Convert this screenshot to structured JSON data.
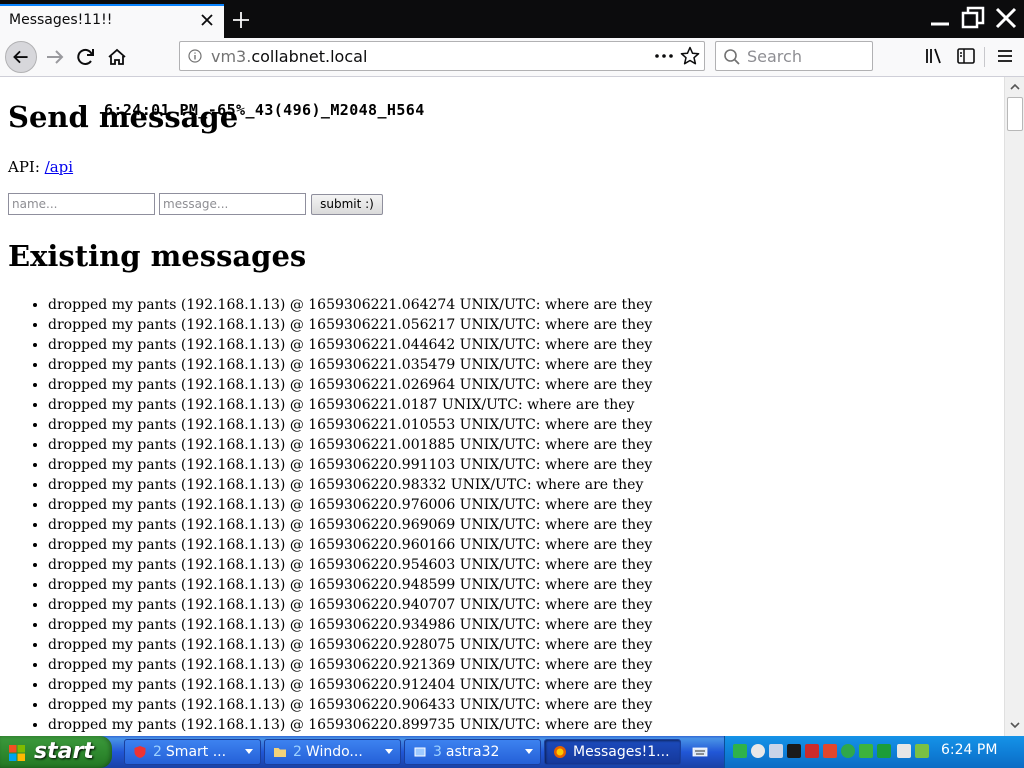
{
  "browser": {
    "tab_title": "Messages!11!!",
    "url_prefix": "vm3.",
    "url_domain": "collabnet.local",
    "search_placeholder": "Search"
  },
  "page": {
    "overlay_stats": "6:24:01 PM_-65%_43(496)_M2048_H564",
    "send_heading": "Send message",
    "api_label": "API: ",
    "api_link": "/api",
    "name_placeholder": "name...",
    "message_placeholder": "message...",
    "submit_label": "submit :)",
    "existing_heading": "Existing messages",
    "messages": [
      "dropped my pants (192.168.1.13) @ 1659306221.064274 UNIX/UTC: where are they",
      "dropped my pants (192.168.1.13) @ 1659306221.056217 UNIX/UTC: where are they",
      "dropped my pants (192.168.1.13) @ 1659306221.044642 UNIX/UTC: where are they",
      "dropped my pants (192.168.1.13) @ 1659306221.035479 UNIX/UTC: where are they",
      "dropped my pants (192.168.1.13) @ 1659306221.026964 UNIX/UTC: where are they",
      "dropped my pants (192.168.1.13) @ 1659306221.0187 UNIX/UTC: where are they",
      "dropped my pants (192.168.1.13) @ 1659306221.010553 UNIX/UTC: where are they",
      "dropped my pants (192.168.1.13) @ 1659306221.001885 UNIX/UTC: where are they",
      "dropped my pants (192.168.1.13) @ 1659306220.991103 UNIX/UTC: where are they",
      "dropped my pants (192.168.1.13) @ 1659306220.98332 UNIX/UTC: where are they",
      "dropped my pants (192.168.1.13) @ 1659306220.976006 UNIX/UTC: where are they",
      "dropped my pants (192.168.1.13) @ 1659306220.969069 UNIX/UTC: where are they",
      "dropped my pants (192.168.1.13) @ 1659306220.960166 UNIX/UTC: where are they",
      "dropped my pants (192.168.1.13) @ 1659306220.954603 UNIX/UTC: where are they",
      "dropped my pants (192.168.1.13) @ 1659306220.948599 UNIX/UTC: where are they",
      "dropped my pants (192.168.1.13) @ 1659306220.940707 UNIX/UTC: where are they",
      "dropped my pants (192.168.1.13) @ 1659306220.934986 UNIX/UTC: where are they",
      "dropped my pants (192.168.1.13) @ 1659306220.928075 UNIX/UTC: where are they",
      "dropped my pants (192.168.1.13) @ 1659306220.921369 UNIX/UTC: where are they",
      "dropped my pants (192.168.1.13) @ 1659306220.912404 UNIX/UTC: where are they",
      "dropped my pants (192.168.1.13) @ 1659306220.906433 UNIX/UTC: where are they",
      "dropped my pants (192.168.1.13) @ 1659306220.899735 UNIX/UTC: where are they"
    ]
  },
  "taskbar": {
    "start_label": "start",
    "tasks": [
      {
        "count": "2",
        "label": "Smart ...",
        "icon": "shield-icon"
      },
      {
        "count": "2",
        "label": "Windo...",
        "icon": "folder-icon"
      },
      {
        "count": "3",
        "label": "astra32",
        "icon": "chip-icon"
      },
      {
        "count": "",
        "label": "Messages!1...",
        "icon": "firefox-icon"
      }
    ],
    "clock": "6:24 PM"
  },
  "colors": {
    "tab_accent": "#0a84ff",
    "link": "#0000ee",
    "taskbar_blue": "#2157d7",
    "start_green": "#2f8a2f",
    "tray_blue": "#0f7fd8"
  }
}
